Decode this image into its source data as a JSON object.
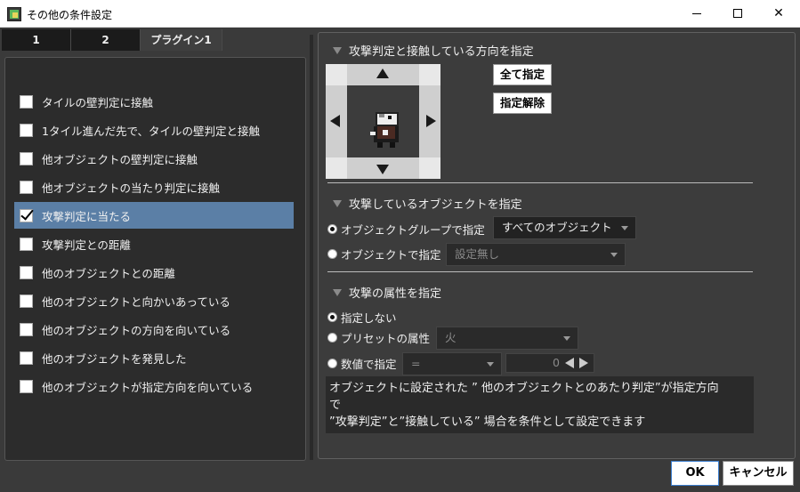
{
  "window": {
    "title": "その他の条件設定",
    "minimize": "—",
    "maximize": "☐",
    "close": "✕"
  },
  "tabs": [
    {
      "label": "1"
    },
    {
      "label": "2"
    },
    {
      "label": "プラグイン1"
    }
  ],
  "conditions": [
    {
      "label": "タイルの壁判定に接触",
      "checked": false
    },
    {
      "label": "1タイル進んだ先で、タイルの壁判定と接触",
      "checked": false
    },
    {
      "label": "他オブジェクトの壁判定に接触",
      "checked": false
    },
    {
      "label": "他オブジェクトの当たり判定に接触",
      "checked": false
    },
    {
      "label": "攻撃判定に当たる",
      "checked": true
    },
    {
      "label": "攻撃判定との距離",
      "checked": false
    },
    {
      "label": "他のオブジェクトとの距離",
      "checked": false
    },
    {
      "label": "他のオブジェクトと向かいあっている",
      "checked": false
    },
    {
      "label": "他のオブジェクトの方向を向いている",
      "checked": false
    },
    {
      "label": "他のオブジェクトを発見した",
      "checked": false
    },
    {
      "label": "他のオブジェクトが指定方向を向いている",
      "checked": false
    }
  ],
  "section_direction": {
    "title": "攻撃判定と接触している方向を指定",
    "select_all": "全て指定",
    "clear": "指定解除"
  },
  "section_object": {
    "title": "攻撃しているオブジェクトを指定",
    "by_group_label": "オブジェクトグループで指定",
    "group_value": "すべてのオブジェクト",
    "by_object_label": "オブジェクトで指定",
    "object_value": "設定無し"
  },
  "section_attribute": {
    "title": "攻撃の属性を指定",
    "none_label": "指定しない",
    "preset_label": "プリセットの属性",
    "preset_value": "火",
    "numeric_label": "数値で指定",
    "operator_value": "=",
    "number_value": "0"
  },
  "description": {
    "line1": "オブジェクトに設定された ” 他のオブジェクトとのあたり判定”が指定方向",
    "line2": "で",
    "line3": "”攻撃判定”と”接触している” 場合を条件として設定できます"
  },
  "buttons": {
    "ok": "OK",
    "cancel": "キャンセル"
  }
}
